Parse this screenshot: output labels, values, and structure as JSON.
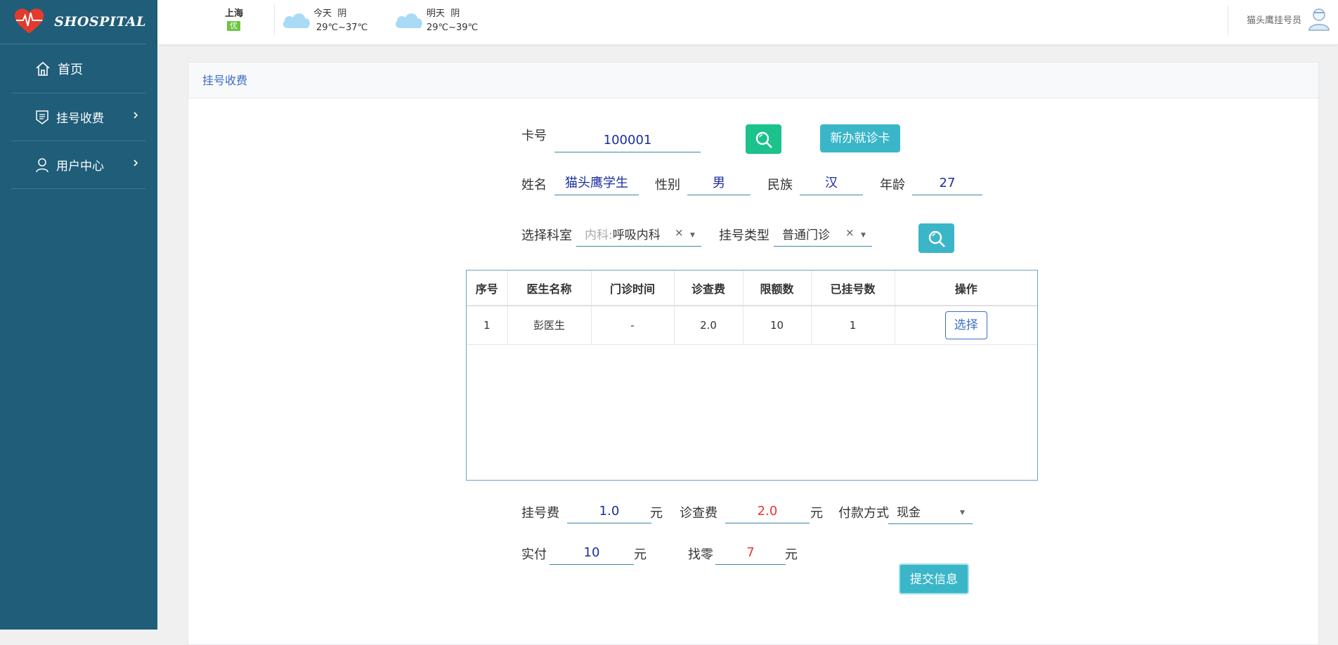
{
  "sidebar": {
    "brand": "SHOSPITAL",
    "items": [
      {
        "label": "首页"
      },
      {
        "label": "挂号收费"
      },
      {
        "label": "用户中心"
      }
    ]
  },
  "topbar": {
    "city": "上海",
    "aqi": "优",
    "today": {
      "label": "今天",
      "weather": "阴",
      "temp": "29℃~37℃"
    },
    "tomorrow": {
      "label": "明天",
      "weather": "阴",
      "temp": "29℃~39℃"
    },
    "user": "猫头鹰挂号员"
  },
  "page": {
    "title": "挂号收费"
  },
  "form": {
    "card_label": "卡号",
    "card_no": "100001",
    "new_card_btn": "新办就诊卡",
    "name_label": "姓名",
    "name": "猫头鹰学生",
    "gender_label": "性别",
    "gender": "男",
    "ethnic_label": "民族",
    "ethnic": "汉",
    "age_label": "年龄",
    "age": "27",
    "dept_label": "选择科室",
    "dept_prefix": "内科:",
    "dept": "呼吸内科",
    "type_label": "挂号类型",
    "type": "普通门诊",
    "reg_fee_label": "挂号费",
    "reg_fee": "1.0",
    "yuan": "元",
    "exam_fee_label": "诊查费",
    "exam_fee": "2.0",
    "pay_label": "付款方式",
    "pay": "现金",
    "paid_label": "实付",
    "paid": "10",
    "change_label": "找零",
    "change": "7",
    "submit": "提交信息"
  },
  "table": {
    "headers": [
      "序号",
      "医生名称",
      "门诊时间",
      "诊查费",
      "限额数",
      "已挂号数",
      "操作"
    ],
    "rows": [
      {
        "no": "1",
        "doctor": "彭医生",
        "time": "-",
        "fee": "2.0",
        "limit": "10",
        "count": "1",
        "action": "选择"
      }
    ]
  },
  "colors": {
    "sidebar": "#1f5d79",
    "accent": "#3bb6c9",
    "search": "#1cc28b",
    "link": "#3c6fc4"
  }
}
